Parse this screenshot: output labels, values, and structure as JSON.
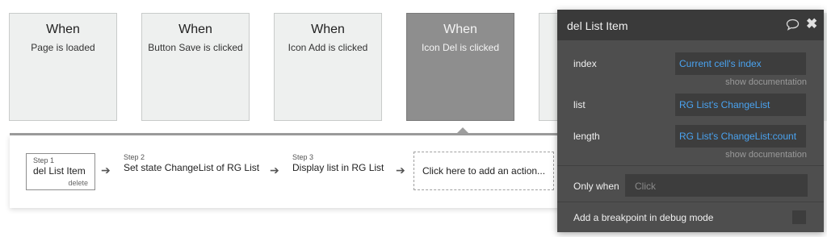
{
  "events": [
    {
      "when": "When",
      "desc": "Page is loaded"
    },
    {
      "when": "When",
      "desc": "Button Save is clicked"
    },
    {
      "when": "When",
      "desc": "Icon Add is clicked"
    },
    {
      "when": "When",
      "desc": "Icon Del is clicked"
    }
  ],
  "workflow": {
    "steps": [
      {
        "num": "Step 1",
        "title": "del List Item",
        "delete_label": "delete"
      },
      {
        "num": "Step 2",
        "title": "Set state ChangeList of RG List"
      },
      {
        "num": "Step 3",
        "title": "Display list in RG List"
      }
    ],
    "add_action": "Click here to add an action..."
  },
  "editor": {
    "title": "del List Item",
    "index_label": "index",
    "index_value": "Current cell's index",
    "list_label": "list",
    "list_value": "RG List's ChangeList",
    "length_label": "length",
    "length_value": "RG List's ChangeList:count",
    "show_doc": "show documentation",
    "only_when_label": "Only when",
    "only_when_placeholder": "Click",
    "breakpoint_label": "Add a breakpoint in debug mode"
  }
}
